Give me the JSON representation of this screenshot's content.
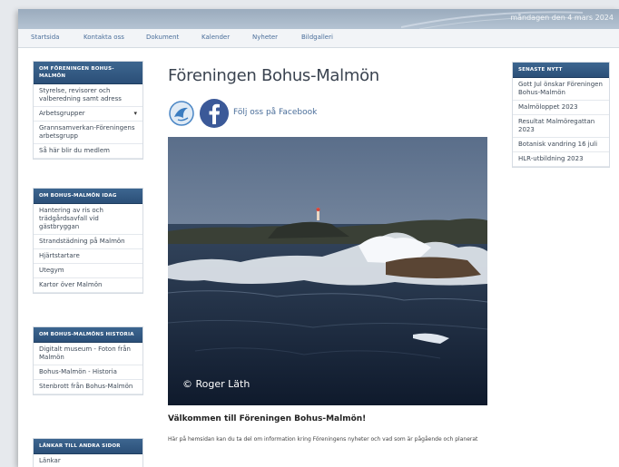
{
  "topbar": {
    "date": "måndagen den 4 mars 2024"
  },
  "nav": [
    "Startsida",
    "Kontakta oss",
    "Dokument",
    "Kalender",
    "Nyheter",
    "Bildgalleri"
  ],
  "sidebar": {
    "sections": [
      {
        "title": "Om Föreningen Bohus-Malmön",
        "items": [
          {
            "label": "Styrelse, revisorer och valberedning samt adress",
            "caret": ""
          },
          {
            "label": "Arbetsgrupper",
            "caret": "▾"
          },
          {
            "label": "Grannsamverkan-Föreningens arbetsgrupp",
            "caret": ""
          },
          {
            "label": "Så här blir du medlem",
            "caret": ""
          }
        ]
      },
      {
        "title": "Om Bohus-Malmön idag",
        "items": [
          {
            "label": "Hantering av ris och trädgårdsavfall vid gästbryggan"
          },
          {
            "label": "Strandstädning på Malmön"
          },
          {
            "label": "Hjärtstartare"
          },
          {
            "label": "Utegym"
          },
          {
            "label": "Kartor över Malmön"
          }
        ]
      },
      {
        "title": "Om Bohus-Malmöns historia",
        "items": [
          {
            "label": "Digitalt museum - Foton från Malmön"
          },
          {
            "label": "Bohus-Malmön - Historia"
          },
          {
            "label": "Stenbrott från Bohus-Malmön"
          }
        ]
      },
      {
        "title": "Länkar till andra sidor",
        "items": [
          {
            "label": "Länkar"
          }
        ]
      }
    ]
  },
  "main": {
    "title": "Föreningen Bohus-Malmön",
    "facebook_link": "Följ oss på Facebook",
    "photo_credit": "© Roger Läth",
    "heading": "Välkommen till Föreningen Bohus-Malmön!",
    "body": "Här på hemsidan kan du ta del om information kring Föreningens nyheter och vad som är pågående och planerat"
  },
  "latest_news": {
    "title": "Senaste nytt",
    "items": [
      "Gott Jul önskar Föreningen Bohus-Malmön",
      "Malmöloppet 2023",
      "Resultat Malmöregattan 2023",
      "Botanisk vandring 16 juli",
      "HLR-utbildning 2023"
    ]
  },
  "colors": {
    "accent": "#2b4f78",
    "link": "#4a6e9a",
    "facebook": "#3b5998"
  }
}
